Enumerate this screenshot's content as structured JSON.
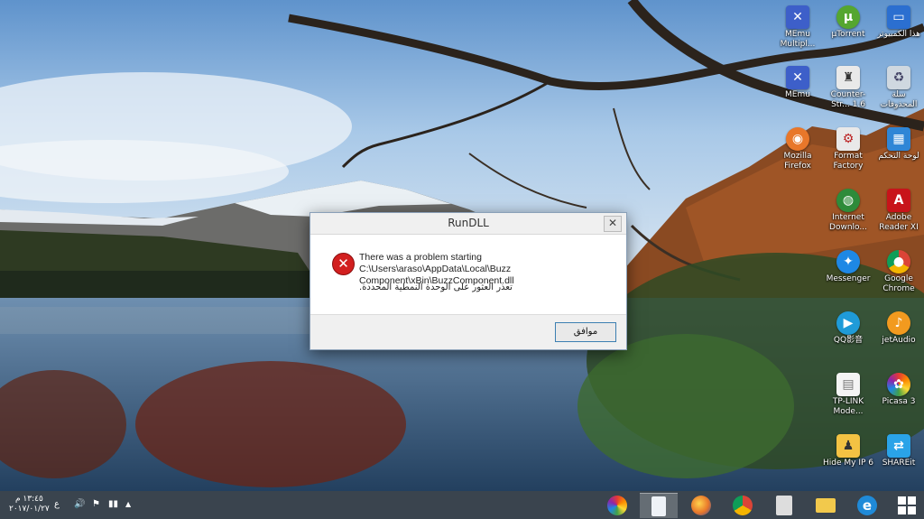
{
  "dialog": {
    "title": "RunDLL",
    "close": "✕",
    "message": "There was a problem starting C:\\Users\\araso\\AppData\\Local\\Buzz Component\\xBin\\BuzzComponent.dll",
    "message_ar": "تعذر العثور على الوحدة النمطية المحددة.",
    "ok": "موافق"
  },
  "desktop_icons": {
    "memu_multi": "MEmu Multipl...",
    "utorrent": "µTorrent",
    "computer": "هذا الكمبيوتر",
    "memu": "MEmu",
    "counter_strike": "Counter-Str... 1.6",
    "recycle": "سلة المحذوفات",
    "firefox": "Mozilla Firefox",
    "format_factory": "Format Factory",
    "control_panel": "لوحة التحكم",
    "idm": "Internet Downlo...",
    "adobe": "Adobe Reader XI",
    "messenger": "Messenger",
    "chrome": "Google Chrome",
    "qq": "QQ影音",
    "jetaudio": "jetAudio",
    "tplink": "TP-LINK Mode...",
    "picasa": "Picasa 3",
    "hidemyip": "Hide My IP 6",
    "shareit": "SHAREit"
  },
  "taskbar": {
    "time": "١٣:٤٥ م",
    "date": "٢٠١٧/٠١/٢٧",
    "lang": "ع",
    "tray_up": "▲"
  },
  "colors": {
    "sky": "#7aa7d6",
    "lake": "#3e5f86",
    "error_red": "#d21f1f"
  }
}
